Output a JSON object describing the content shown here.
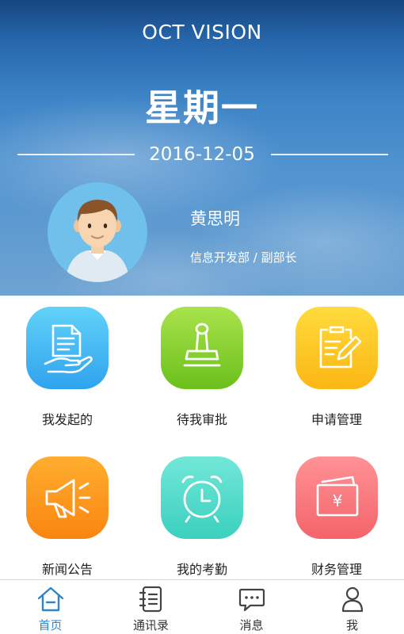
{
  "app": {
    "title": "OCT VISION"
  },
  "hero": {
    "weekday": "星期一",
    "date": "2016-12-05"
  },
  "user": {
    "name": "黄思明",
    "department": "信息开发部 / 副部长",
    "avatar_icon": "user-avatar-icon"
  },
  "grid": {
    "items": [
      {
        "label": "我发起的",
        "icon": "document-hand-icon",
        "color_top": "#5fd0f7",
        "color_bottom": "#2fa4ee"
      },
      {
        "label": "待我审批",
        "icon": "stamp-icon",
        "color_top": "#a6e24a",
        "color_bottom": "#6cc11c"
      },
      {
        "label": "申请管理",
        "icon": "form-edit-icon",
        "color_top": "#ffd93a",
        "color_bottom": "#fbb914"
      },
      {
        "label": "新闻公告",
        "icon": "megaphone-icon",
        "color_top": "#ffad2e",
        "color_bottom": "#fb8612"
      },
      {
        "label": "我的考勤",
        "icon": "alarm-clock-icon",
        "color_top": "#6ee6d7",
        "color_bottom": "#3dd1bf"
      },
      {
        "label": "财务管理",
        "icon": "wallet-yen-icon",
        "color_top": "#ff8f93",
        "color_bottom": "#f5676c"
      }
    ]
  },
  "nav": {
    "items": [
      {
        "label": "首页",
        "icon": "home-icon",
        "active": true
      },
      {
        "label": "通讯录",
        "icon": "contacts-book-icon",
        "active": false
      },
      {
        "label": "消息",
        "icon": "chat-bubble-icon",
        "active": false
      },
      {
        "label": "我",
        "icon": "person-icon",
        "active": false
      }
    ],
    "active_color": "#2d86c8"
  },
  "icon_glyphs": {
    "finance_symbol": "¥"
  }
}
